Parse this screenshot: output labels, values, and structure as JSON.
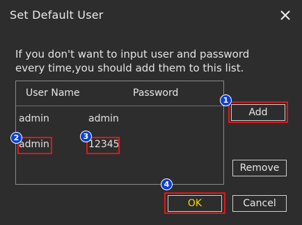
{
  "dialog": {
    "title": "Set Default User",
    "description": "If you don't want to input user and password every time,you should add them to this list."
  },
  "list": {
    "headers": {
      "user": "User Name",
      "password": "Password"
    },
    "rows": [
      {
        "user": "admin",
        "password": "admin"
      },
      {
        "user": "admin",
        "password": "12345"
      }
    ]
  },
  "buttons": {
    "add": "Add",
    "remove": "Remove",
    "ok": "OK",
    "cancel": "Cancel"
  },
  "annotations": {
    "badges": [
      "1",
      "2",
      "3",
      "4"
    ],
    "highlight_color": "#e01818",
    "badge_color": "#0b3fd6"
  },
  "icons": {
    "close": "close-icon"
  }
}
